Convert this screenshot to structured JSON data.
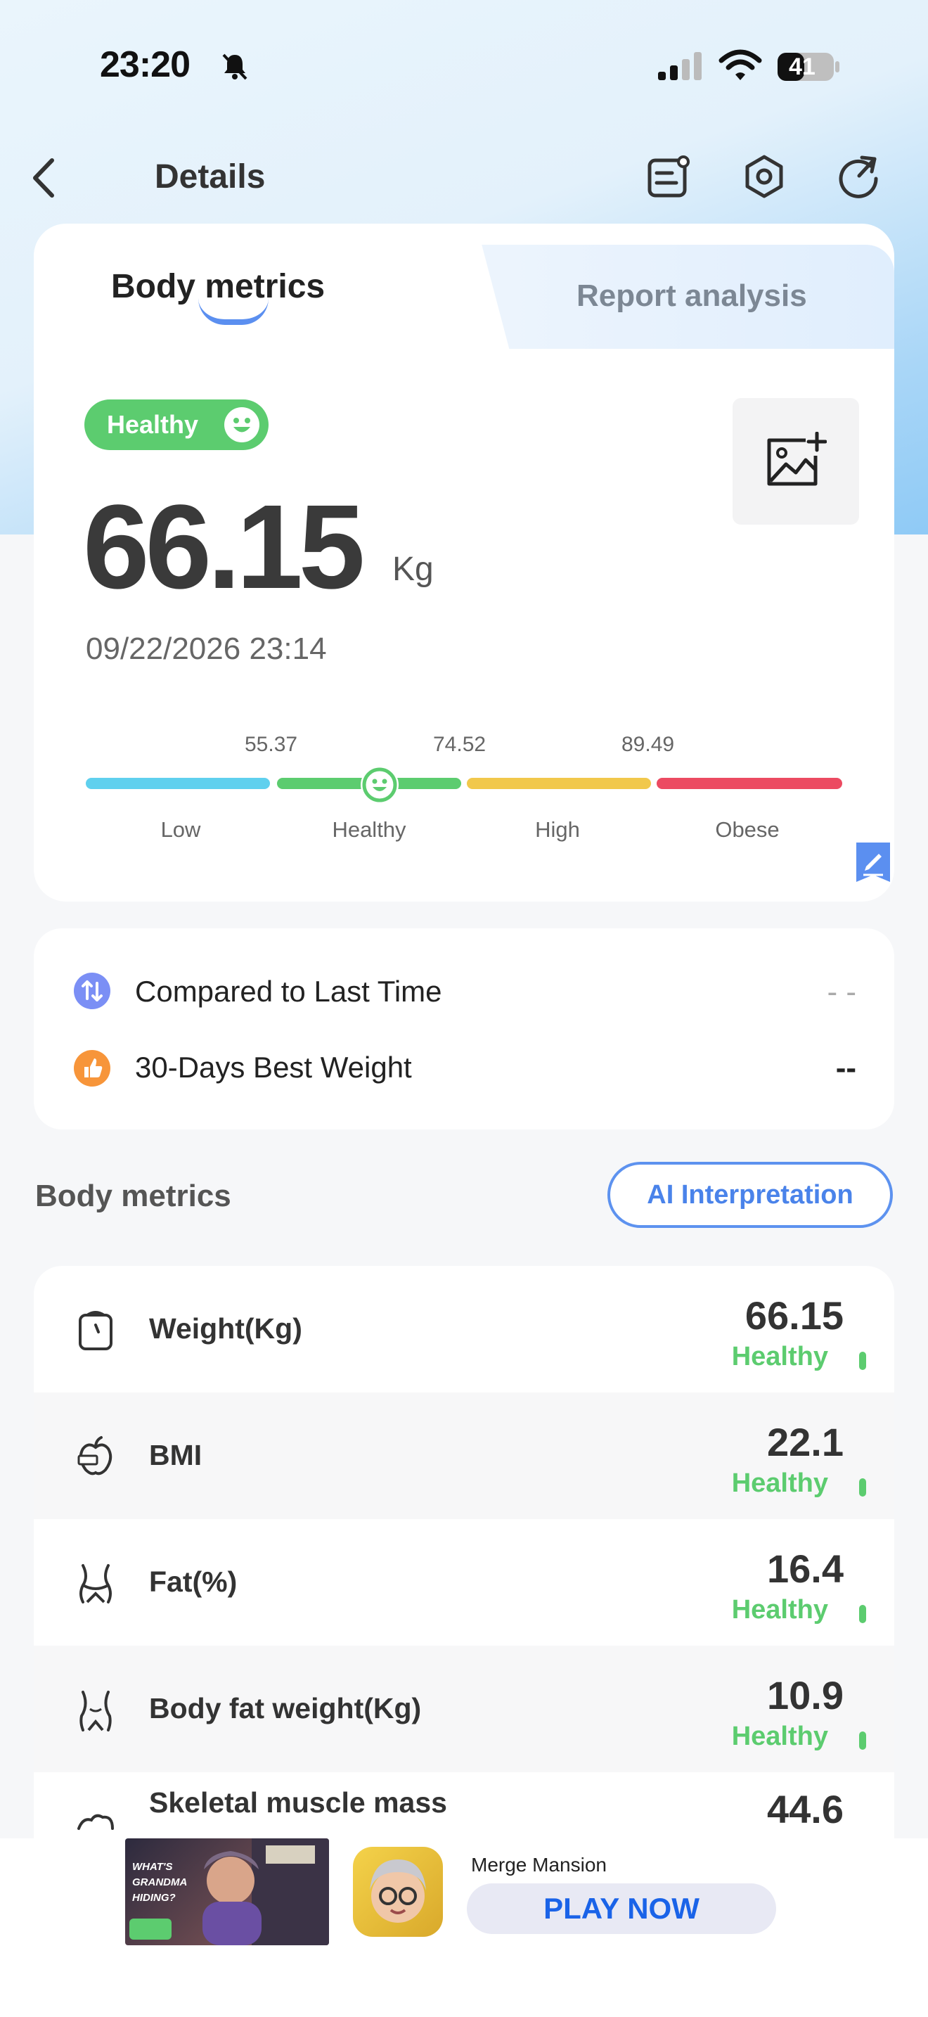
{
  "status_bar": {
    "time": "23:20",
    "battery": "41"
  },
  "nav": {
    "title": "Details"
  },
  "tabs": [
    {
      "label": "Body metrics",
      "active": true
    },
    {
      "label": "Report analysis",
      "active": false
    }
  ],
  "summary": {
    "status_badge": "Healthy",
    "weight": "66.15",
    "unit": "Kg",
    "datetime": "09/22/2026 23:14",
    "scale": {
      "thresholds": [
        "55.37",
        "74.52",
        "89.49"
      ],
      "segments": [
        {
          "label": "Low",
          "color": "#5fd0ee"
        },
        {
          "label": "Healthy",
          "color": "#5ccc6f"
        },
        {
          "label": "High",
          "color": "#f1c84b"
        },
        {
          "label": "Obese",
          "color": "#ec4a61"
        }
      ],
      "current_segment": "Healthy"
    }
  },
  "compare": {
    "last_time": {
      "label": "Compared to Last Time",
      "value": "- -"
    },
    "best_weight": {
      "label": "30-Days Best Weight",
      "value": "--"
    }
  },
  "metrics_section": {
    "title": "Body metrics",
    "ai_button": "AI Interpretation",
    "rows": [
      {
        "label": "Weight(Kg)",
        "value": "66.15",
        "status": "Healthy",
        "icon": "scale-icon"
      },
      {
        "label": "BMI",
        "value": "22.1",
        "status": "Healthy",
        "icon": "apple-tape-icon"
      },
      {
        "label": "Fat(%)",
        "value": "16.4",
        "status": "Healthy",
        "icon": "waist-icon"
      },
      {
        "label": "Body fat weight(Kg)",
        "value": "10.9",
        "status": "Healthy",
        "icon": "torso-icon"
      },
      {
        "label": "Skeletal muscle mass",
        "value": "44.6",
        "status": "",
        "icon": "muscle-icon"
      }
    ]
  },
  "ad": {
    "banner_text": "WHAT'S GRANDMA HIDING?",
    "app_name": "Merge Mansion",
    "cta": "PLAY NOW"
  },
  "colors": {
    "accent": "#4a83ea",
    "healthy": "#5ccc6f"
  }
}
